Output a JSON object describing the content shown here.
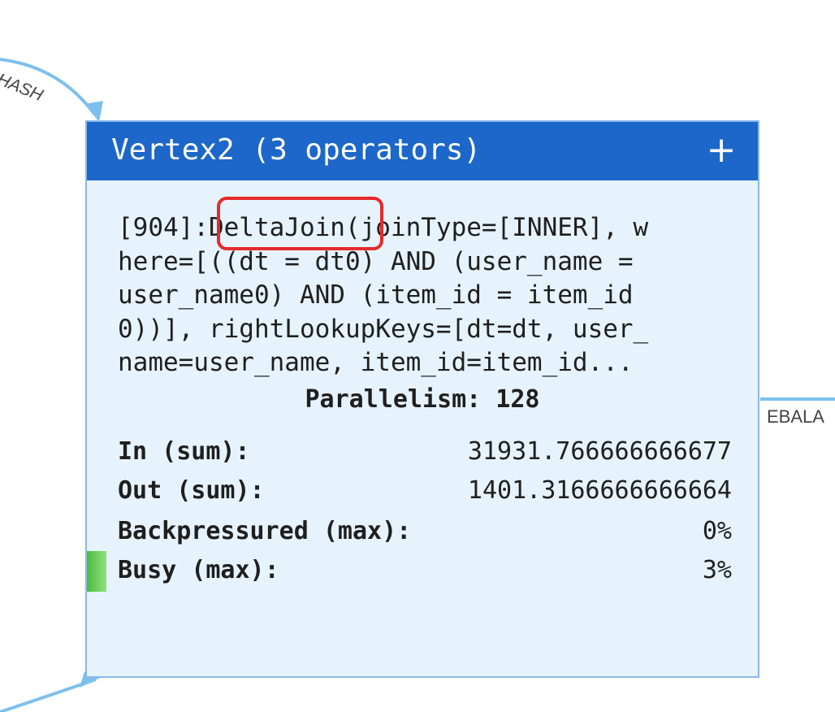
{
  "edges": {
    "incoming_label": "HASH",
    "outgoing_label": "EBALA"
  },
  "vertex": {
    "title": "Vertex2 (3 operators)",
    "expand_icon": "plus-icon",
    "description_lines": [
      "[904]:DeltaJoin(joinType=[INNER], w",
      "here=[((dt = dt0) AND (user_name =",
      "user_name0) AND (item_id = item_id",
      "0))], rightLookupKeys=[dt=dt, user_",
      "name=user_name, item_id=item_id..."
    ],
    "parallelism": "Parallelism: 128",
    "metrics": [
      {
        "label": "In (sum):",
        "value": "31931.766666666677"
      },
      {
        "label": "Out (sum):",
        "value": "1401.3166666666664"
      },
      {
        "label": "Backpressured (max):",
        "value": "0%"
      },
      {
        "label": "Busy (max):",
        "value": "3%"
      }
    ],
    "busy_fraction": 0.03
  },
  "colors": {
    "header": "#1c67c9",
    "body": "#e6f3fd",
    "border": "#8ab8ec",
    "edge": "#7cc0ee",
    "highlight": "#e52a2a",
    "busy_indicator": "#4dbb3e"
  }
}
